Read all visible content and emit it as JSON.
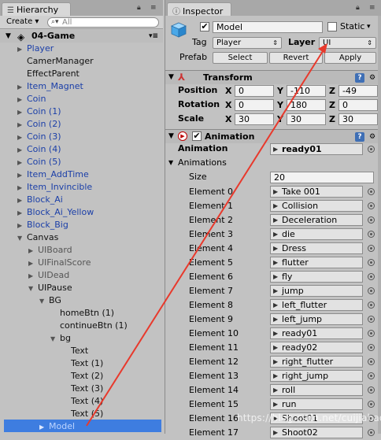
{
  "hierarchy": {
    "tab_title": "Hierarchy",
    "create_label": "Create ▾",
    "search_placeholder": "All",
    "scene_name": "04-Game",
    "items": [
      {
        "label": "Player",
        "color": "blue",
        "arrow": "▶"
      },
      {
        "label": "CamerManager",
        "color": "black",
        "arrow": ""
      },
      {
        "label": "EffectParent",
        "color": "black",
        "arrow": ""
      },
      {
        "label": "Item_Magnet",
        "color": "blue",
        "arrow": "▶"
      },
      {
        "label": "Coin",
        "color": "blue",
        "arrow": "▶"
      },
      {
        "label": "Coin (1)",
        "color": "blue",
        "arrow": "▶"
      },
      {
        "label": "Coin (2)",
        "color": "blue",
        "arrow": "▶"
      },
      {
        "label": "Coin (3)",
        "color": "blue",
        "arrow": "▶"
      },
      {
        "label": "Coin (4)",
        "color": "blue",
        "arrow": "▶"
      },
      {
        "label": "Coin (5)",
        "color": "blue",
        "arrow": "▶"
      },
      {
        "label": "Item_AddTime",
        "color": "blue",
        "arrow": "▶"
      },
      {
        "label": "Item_Invincible",
        "color": "blue",
        "arrow": "▶"
      },
      {
        "label": "Block_Ai",
        "color": "blue",
        "arrow": "▶"
      },
      {
        "label": "Block_Ai_Yellow",
        "color": "blue",
        "arrow": "▶"
      },
      {
        "label": "Block_Big",
        "color": "blue",
        "arrow": "▶"
      },
      {
        "label": "Canvas",
        "color": "black",
        "arrow": "▼"
      },
      {
        "label": "UIBoard",
        "color": "gray",
        "arrow": "▶"
      },
      {
        "label": "UIFinalScore",
        "color": "gray",
        "arrow": "▶"
      },
      {
        "label": "UIDead",
        "color": "gray",
        "arrow": "▶"
      },
      {
        "label": "UIPause",
        "color": "black",
        "arrow": "▼"
      },
      {
        "label": "BG",
        "color": "black",
        "arrow": "▼"
      },
      {
        "label": "homeBtn (1)",
        "color": "black",
        "arrow": ""
      },
      {
        "label": "continueBtn (1)",
        "color": "black",
        "arrow": ""
      },
      {
        "label": "bg",
        "color": "black",
        "arrow": "▼"
      },
      {
        "label": "Text",
        "color": "black",
        "arrow": ""
      },
      {
        "label": "Text (1)",
        "color": "black",
        "arrow": ""
      },
      {
        "label": "Text (2)",
        "color": "black",
        "arrow": ""
      },
      {
        "label": "Text (3)",
        "color": "black",
        "arrow": ""
      },
      {
        "label": "Text (4)",
        "color": "black",
        "arrow": ""
      },
      {
        "label": "Text (5)",
        "color": "black",
        "arrow": ""
      },
      {
        "label": "Model",
        "color": "selected",
        "arrow": "▶"
      }
    ]
  },
  "inspector": {
    "tab_title": "Inspector",
    "object_name": "Model",
    "static_label": "Static",
    "tag_label": "Tag",
    "tag_value": "Player",
    "layer_label": "Layer",
    "layer_value": "UI",
    "prefab_label": "Prefab",
    "prefab_buttons": [
      "Select",
      "Revert",
      "Apply"
    ],
    "transform": {
      "title": "Transform",
      "rows": [
        {
          "label": "Position",
          "x": "0",
          "y": "-110",
          "z": "-49"
        },
        {
          "label": "Rotation",
          "x": "0",
          "y": "180",
          "z": "0"
        },
        {
          "label": "Scale",
          "x": "30",
          "y": "30",
          "z": "30"
        }
      ]
    },
    "animation": {
      "title": "Animation",
      "clip_label": "Animation",
      "clip_value": "ready01",
      "animations_label": "Animations",
      "size_label": "Size",
      "size_value": "20",
      "elements": [
        {
          "label": "Element 0",
          "value": "Take 001"
        },
        {
          "label": "Element 1",
          "value": "Collision"
        },
        {
          "label": "Element 2",
          "value": "Deceleration"
        },
        {
          "label": "Element 3",
          "value": "die"
        },
        {
          "label": "Element 4",
          "value": "Dress"
        },
        {
          "label": "Element 5",
          "value": "flutter"
        },
        {
          "label": "Element 6",
          "value": "fly"
        },
        {
          "label": "Element 7",
          "value": "jump"
        },
        {
          "label": "Element 8",
          "value": "left_flutter"
        },
        {
          "label": "Element 9",
          "value": "left_jump"
        },
        {
          "label": "Element 10",
          "value": "ready01"
        },
        {
          "label": "Element 11",
          "value": "ready02"
        },
        {
          "label": "Element 12",
          "value": "right_flutter"
        },
        {
          "label": "Element 13",
          "value": "right_jump"
        },
        {
          "label": "Element 14",
          "value": "roll"
        },
        {
          "label": "Element 15",
          "value": "run"
        },
        {
          "label": "Element 16",
          "value": "Shoot01"
        },
        {
          "label": "Element 17",
          "value": "Shoot02"
        }
      ]
    }
  },
  "watermark": "https://blog.csdn.net/cuijiahao",
  "colors": {
    "annotation_arrow": "#e8392c",
    "selection": "#3e7de0",
    "tree_blue": "#1b3fa8"
  }
}
